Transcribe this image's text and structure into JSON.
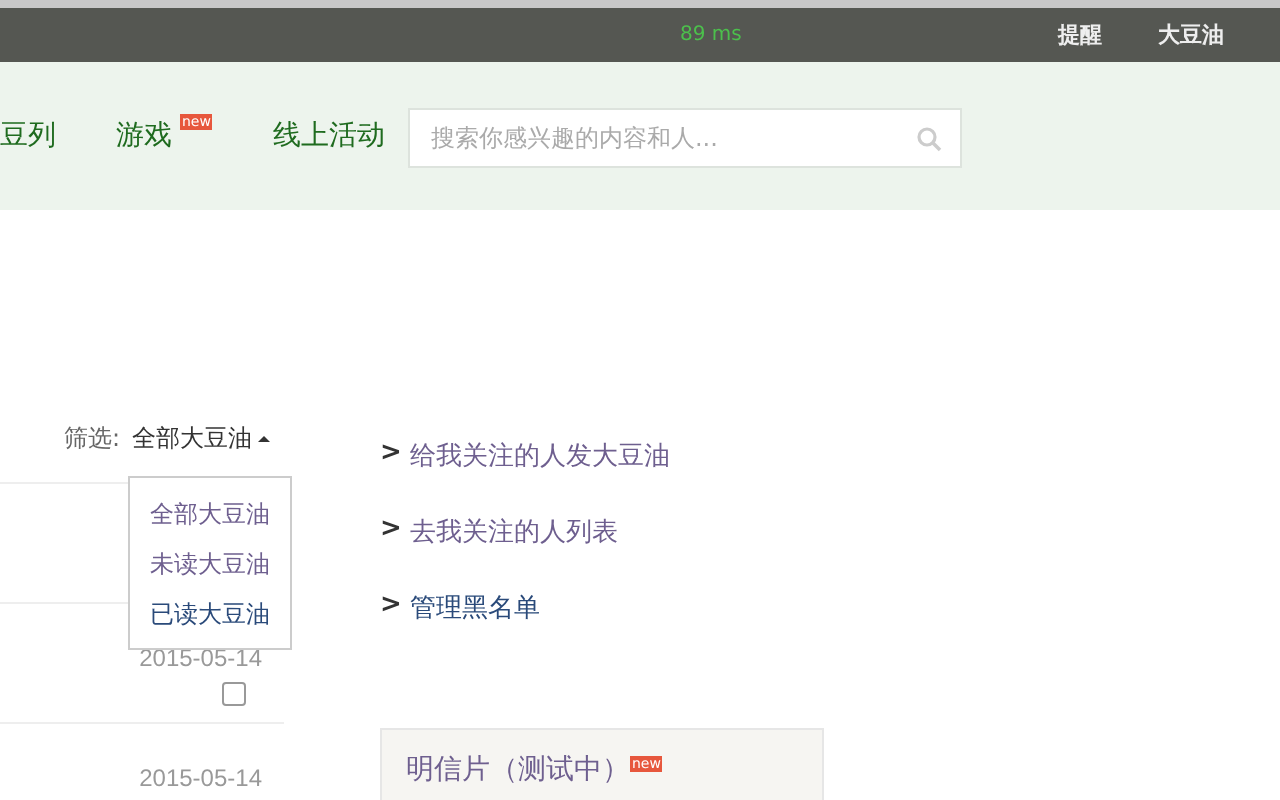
{
  "top_bar": {
    "timing": "89 ms",
    "links": [
      "提醒",
      "大豆油"
    ]
  },
  "nav": {
    "items": [
      {
        "label": "豆列"
      },
      {
        "label": "游戏",
        "badge": "new"
      },
      {
        "label": "线上活动"
      }
    ]
  },
  "search": {
    "placeholder": "搜索你感兴趣的内容和人..."
  },
  "filter": {
    "label": "筛选:",
    "value": "全部大豆油",
    "expanded": true,
    "options": [
      {
        "label": "全部大豆油",
        "visited": true
      },
      {
        "label": "未读大豆油",
        "visited": true
      },
      {
        "label": "已读大豆油",
        "visited": false
      }
    ]
  },
  "messages": [
    {
      "date": "2015-05-14",
      "checked": false
    },
    {
      "date": "2015-05-14"
    }
  ],
  "links": [
    {
      "marker": ">",
      "label": "给我关注的人发大豆油",
      "visited": true
    },
    {
      "marker": ">",
      "label": "去我关注的人列表",
      "visited": true
    },
    {
      "marker": ">",
      "label": "管理黑名单",
      "visited": false
    }
  ],
  "card": {
    "title": "明信片（测试中）",
    "badge": "new"
  }
}
